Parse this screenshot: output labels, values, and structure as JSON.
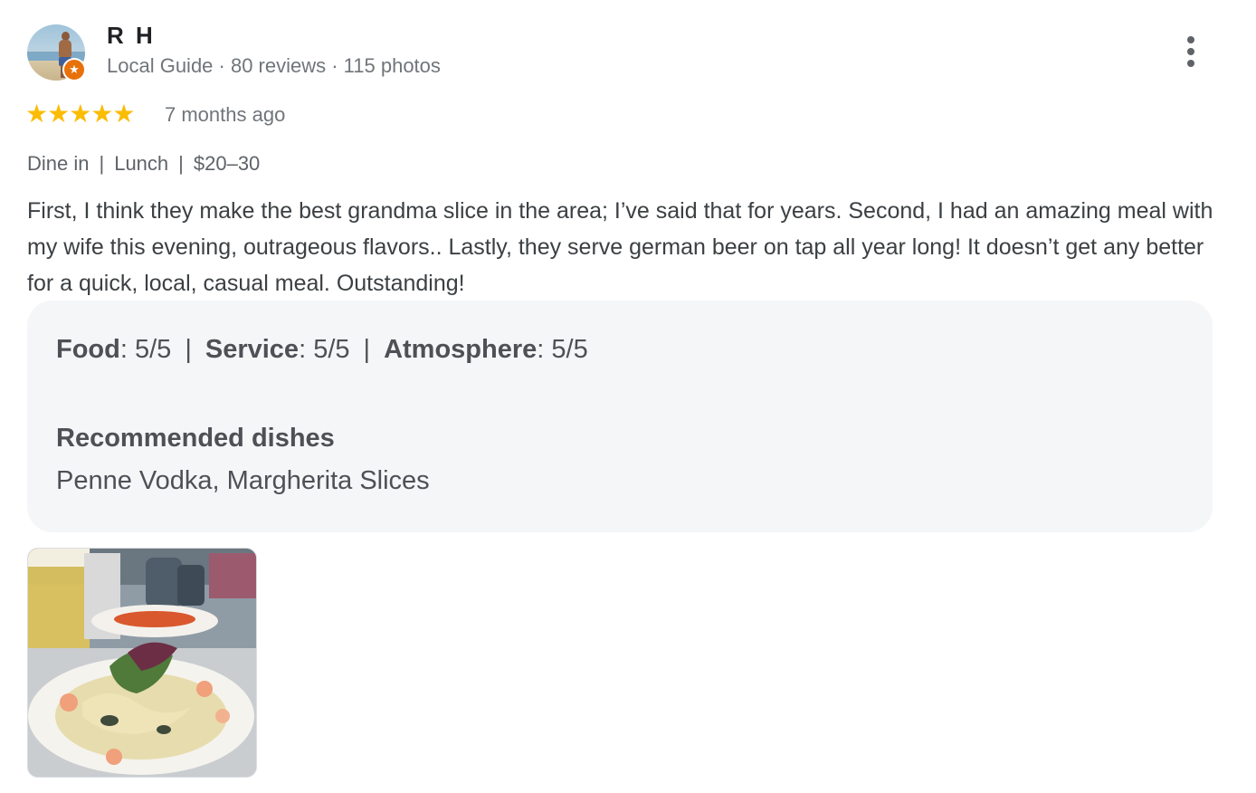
{
  "reviewer": {
    "name": "R H",
    "meta": "Local Guide · 80 reviews · 115 photos",
    "badge_icon": "local-guide-star-icon"
  },
  "review": {
    "stars": 5,
    "stars_text": "★★★★★",
    "date": "7 months ago",
    "tags": [
      "Dine in",
      "Lunch",
      "$20–30"
    ],
    "tag_separator": "|",
    "text": "First, I think they make the best grandma slice in the area; I’ve said that for years. Second, I had an amazing meal with my wife this evening, outrageous flavors.. Lastly, they serve german beer on tap all year long! It doesn’t get any better for a quick, local, casual meal. Outstanding!"
  },
  "details": {
    "ratings": [
      {
        "label": "Food",
        "value": "5/5"
      },
      {
        "label": "Service",
        "value": "5/5"
      },
      {
        "label": "Atmosphere",
        "value": "5/5"
      }
    ],
    "recommended_title": "Recommended dishes",
    "recommended_value": "Penne Vodka, Margherita Slices"
  },
  "colors": {
    "star": "#fbbc04",
    "badge": "#e8710a",
    "details_bg": "#f5f6f8"
  }
}
